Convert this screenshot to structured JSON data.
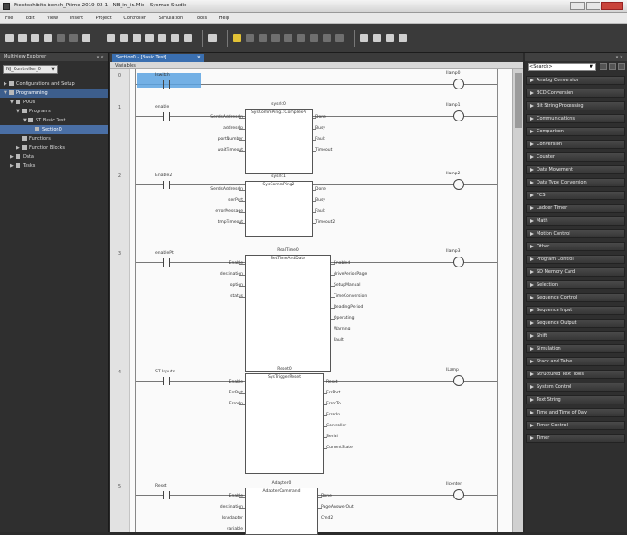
{
  "window": {
    "title": "Ftestexhibits-bench_Ptime-2019-02-1 - NB_in_in.Mie - Sysmac Studio"
  },
  "menu": [
    "File",
    "Edit",
    "View",
    "Insert",
    "Project",
    "Controller",
    "Simulation",
    "Tools",
    "Help"
  ],
  "explorer": {
    "title": "Multiview Explorer",
    "controller": "NJ_Controller_0",
    "items": [
      {
        "label": "Configurations and Setup",
        "indent": 0,
        "twist": "▶",
        "state": ""
      },
      {
        "label": "Programming",
        "indent": 0,
        "twist": "▼",
        "state": "hl"
      },
      {
        "label": "POUs",
        "indent": 1,
        "twist": "▼",
        "state": ""
      },
      {
        "label": "Programs",
        "indent": 2,
        "twist": "▼",
        "state": ""
      },
      {
        "label": "ST Basic Test",
        "indent": 3,
        "twist": "▼",
        "state": ""
      },
      {
        "label": "Section0",
        "indent": 4,
        "twist": "",
        "state": "sel"
      },
      {
        "label": "Functions",
        "indent": 2,
        "twist": "",
        "state": ""
      },
      {
        "label": "Function Blocks",
        "indent": 2,
        "twist": "▶",
        "state": ""
      },
      {
        "label": "Data",
        "indent": 1,
        "twist": "▶",
        "state": ""
      },
      {
        "label": "Tasks",
        "indent": 1,
        "twist": "▶",
        "state": ""
      }
    ]
  },
  "editor": {
    "tab": "Section0 - [Basic Test]",
    "variables_label": "Variables"
  },
  "ladder": {
    "rungs": [
      {
        "num": "0",
        "contact": "Iswitch",
        "coil": "Ilamp0"
      },
      {
        "num": "1",
        "contact": "enable",
        "coil": "Ilamp1",
        "fb": {
          "inst": "sysrlc0",
          "type": "SysCommPing1:ComplexPi",
          "pins_in": [
            "SendsAddressIn",
            "addressIp",
            "portNumber",
            "waitTimeout"
          ],
          "pins_out": [
            "Done",
            "Busy",
            "Fault",
            "Timeout"
          ]
        }
      },
      {
        "num": "2",
        "contact": "Enable2",
        "coil": "Ilamp2",
        "fb": {
          "inst": "sysrlc1",
          "type": "SysCommPing2",
          "pins_in": [
            "SendsAddressIn",
            "serPort",
            "errorMessage",
            "tmpTimeout"
          ],
          "pins_out": [
            "Done",
            "Busy",
            "Fault",
            "Timeout2"
          ]
        }
      },
      {
        "num": "3",
        "contact": "enablePt",
        "coil": "Ilamp3",
        "fb": {
          "inst": "RealTime0",
          "type": "SetTimeAndDate",
          "pins_in": [
            "Enable",
            "destination",
            "option",
            "status"
          ],
          "pins_out": [
            "Enabled",
            "drivePeriodPage",
            "SetupManual",
            "TimeConversion",
            "ReadingPeriod",
            "Operating",
            "Warning",
            "Fault"
          ]
        }
      },
      {
        "num": "4",
        "contact": "ST Inputs",
        "coil": "ILamp",
        "fb": {
          "inst": "Reset0",
          "type": "SysTriggerReset",
          "pins_in": [
            "Enable",
            "ErrPort",
            "ErrorIn"
          ],
          "pins_out": [
            "Reset",
            "ErrPort",
            "ErrorTo",
            "ErrorIn",
            "Controller",
            "Serial",
            "CurrentState"
          ]
        }
      },
      {
        "num": "5",
        "contact": "Reset",
        "coil": "Ilcenter",
        "fb": {
          "inst": "Adapter0",
          "type": "AdapterCommand",
          "pins_in": [
            "Enable",
            "destination",
            "IsrAdapter",
            "variable"
          ],
          "pins_out": [
            "Done",
            "PageAnswerOut",
            "Cmd2"
          ]
        }
      }
    ]
  },
  "toolbox": {
    "search": "<Search>",
    "items": [
      "Analog Conversion",
      "BCD Conversion",
      "Bit String Processing",
      "Communications",
      "Comparison",
      "Conversion",
      "Counter",
      "Data Movement",
      "Data Type Conversion",
      "FCS",
      "Ladder Timer",
      "Math",
      "Motion Control",
      "Other",
      "Program Control",
      "SD Memory Card",
      "Selection",
      "Sequence Control",
      "Sequence Input",
      "Sequence Output",
      "Shift",
      "Simulation",
      "Stack and Table",
      "Structured Text Tools",
      "System Control",
      "Text String",
      "Time and Time of Day",
      "Timer Control",
      "Timer"
    ]
  }
}
